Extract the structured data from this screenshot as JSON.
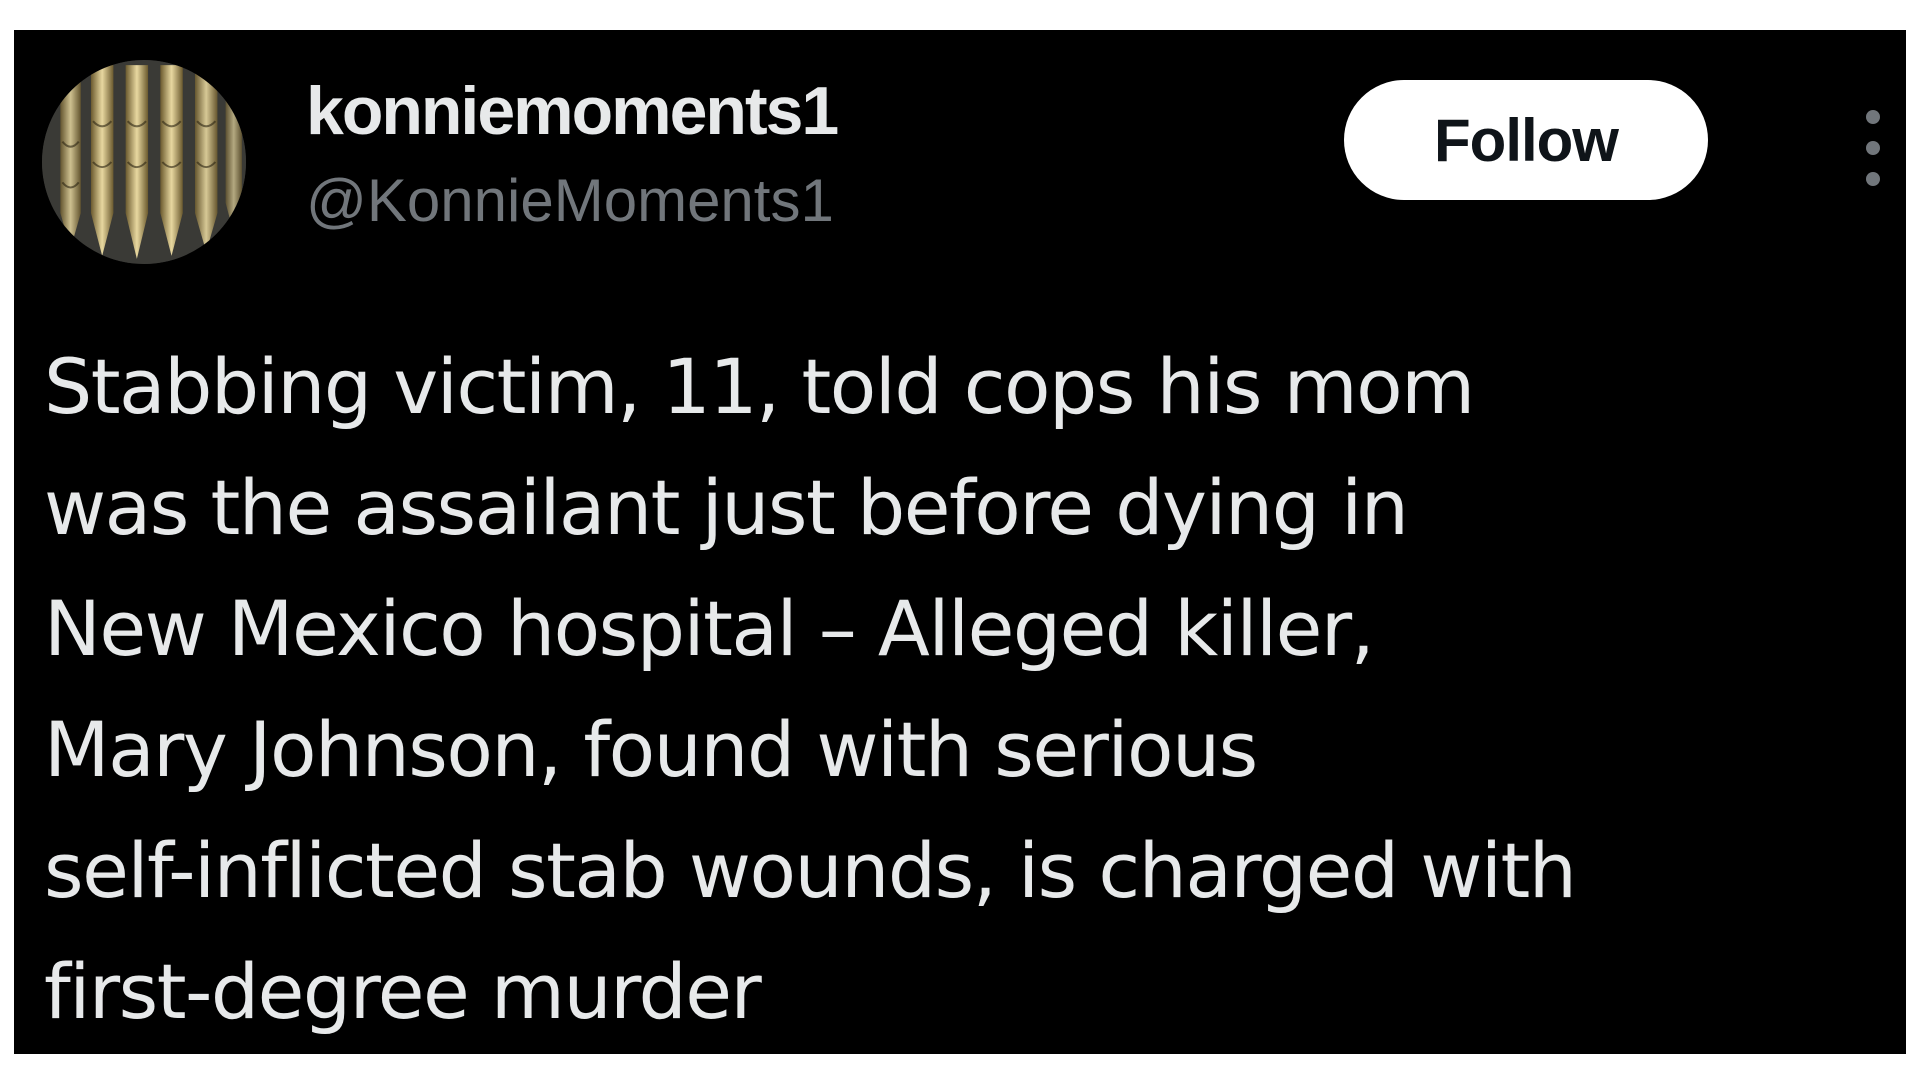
{
  "tweet": {
    "display_name": "konniemoments1",
    "handle": "@KonnieMoments1",
    "follow_label": "Follow",
    "avatar_icon": "fountain-pens-avatar",
    "more_icon": "more-vertical-icon",
    "text_lines": [
      "Stabbing victim, 11, told cops his mom",
      "was the assailant just before dying in",
      "New Mexico hospital – Alleged killer,",
      "Mary Johnson, found with serious",
      "self-inflicted stab wounds, is charged with",
      "first-degree murder"
    ]
  },
  "colors": {
    "background": "#000000",
    "primary_text": "#e7e9ea",
    "secondary_text": "#71767b",
    "follow_button_bg": "#ffffff",
    "follow_button_text": "#0f1419"
  }
}
